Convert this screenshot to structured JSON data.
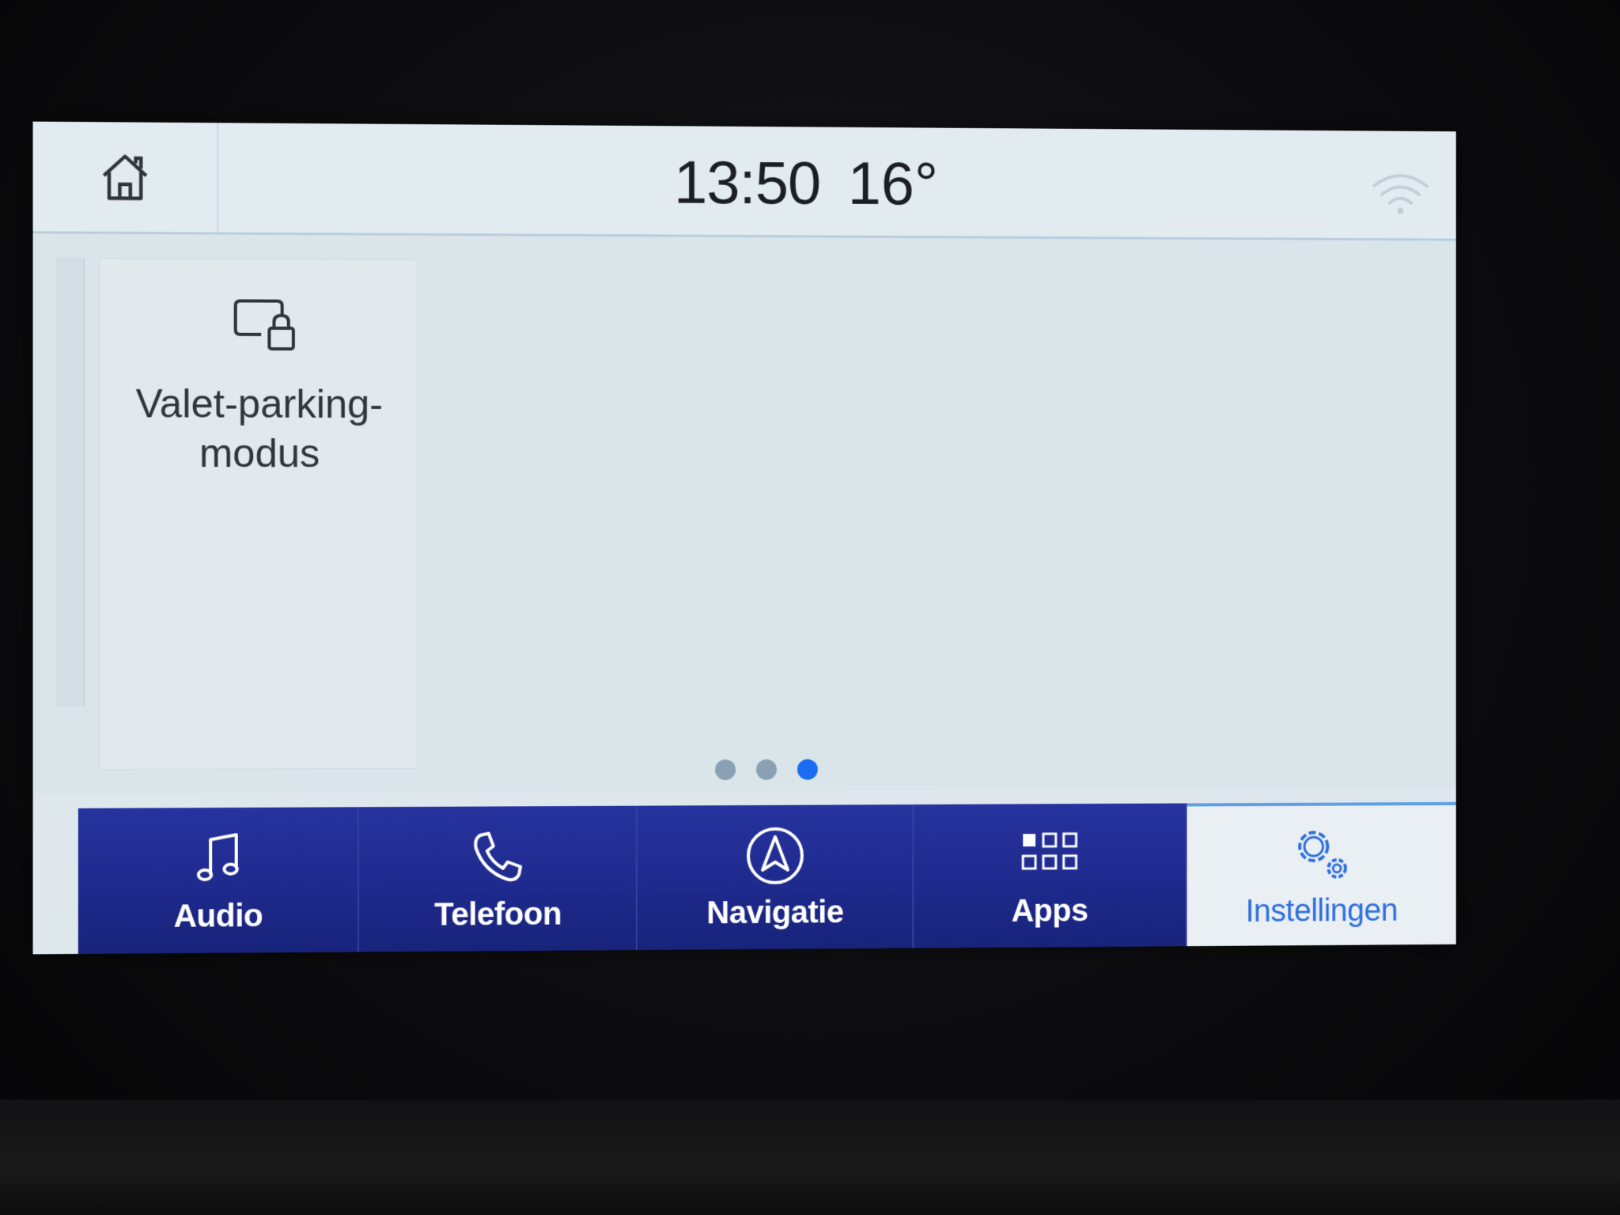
{
  "status_bar": {
    "time": "13:50",
    "temperature": "16°",
    "home_icon": "home-icon",
    "wifi_icon": "wifi-icon"
  },
  "content": {
    "tiles": [
      {
        "label": "Valet-parking-\nmodus",
        "icon": "screen-lock-icon"
      }
    ],
    "pagination": {
      "pages": 3,
      "active_page": 3
    }
  },
  "navbar": {
    "items": [
      {
        "label": "Audio",
        "icon": "music-note-icon"
      },
      {
        "label": "Telefoon",
        "icon": "phone-icon"
      },
      {
        "label": "Navigatie",
        "icon": "navigation-arrow-icon"
      },
      {
        "label": "Apps",
        "icon": "apps-grid-icon"
      },
      {
        "label": "Instellingen",
        "icon": "gear-icon",
        "active": true
      }
    ]
  },
  "colors": {
    "nav_background": "#1e2a8d",
    "active_accent": "#2f6fe0",
    "page_dot_active": "#1a6cf0",
    "screen_background": "#dae5ea"
  }
}
